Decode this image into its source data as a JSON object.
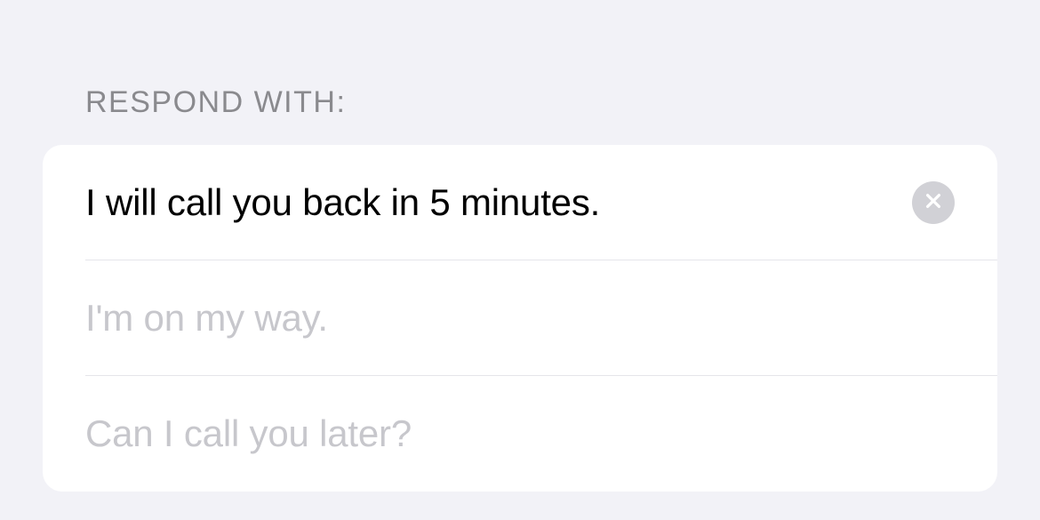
{
  "section": {
    "header": "Respond with:"
  },
  "responses": [
    {
      "value": "I will call you back in 5 minutes.",
      "placeholder": "",
      "hasValue": true
    },
    {
      "value": "",
      "placeholder": "I'm on my way.",
      "hasValue": false
    },
    {
      "value": "",
      "placeholder": "Can I call you later?",
      "hasValue": false
    }
  ]
}
